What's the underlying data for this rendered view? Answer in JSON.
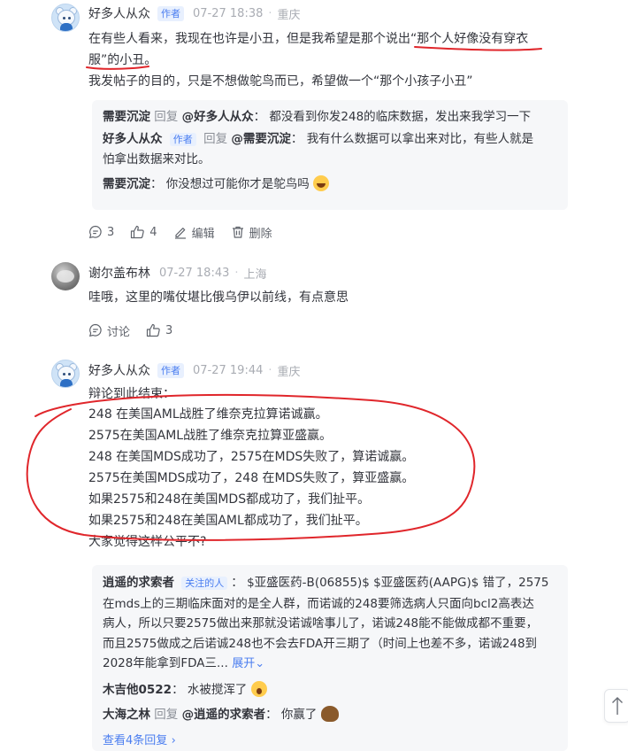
{
  "post1": {
    "username": "好多人从众",
    "badge": "作者",
    "time": "07-27 18:38",
    "location": "重庆",
    "lines": [
      "在有些人看来，我现在也许是小丑，但是我希望是那个说出“那个人好像没有穿衣",
      "服”的小丑。",
      "我发帖子的目的，只是不想做鸵鸟而已，希望做一个“那个小孩子小丑”"
    ],
    "replies": [
      {
        "user": "需要沉淀",
        "reply_label": "回复",
        "target": "@好多人从众",
        "text": "都没看到你发248的临床数据，发出来我学习一下"
      },
      {
        "user": "好多人从众",
        "badge": "作者",
        "reply_label": "回复",
        "target": "@需要沉淀",
        "text_line1": "我有什么数据可以拿出来对比，有些人就是",
        "text_line2": "怕拿出数据来对比。"
      },
      {
        "user": "需要沉淀",
        "text": "你没想过可能你才是鸵鸟吗"
      }
    ],
    "actions": {
      "comments": "3",
      "likes": "4",
      "edit": "编辑",
      "delete": "删除"
    }
  },
  "post2": {
    "username": "谢尔盖布林",
    "time": "07-27 18:43",
    "location": "上海",
    "text": "哇哦，这里的嘴仗堪比俄乌伊以前线，有点意思",
    "actions": {
      "comments": "讨论",
      "likes": "3"
    }
  },
  "post3": {
    "username": "好多人从众",
    "badge": "作者",
    "time": "07-27 19:44",
    "location": "重庆",
    "lines": [
      "辩论到此结束：",
      "248 在美国AML战胜了维奈克拉算诺诚赢。",
      "2575在美国AML战胜了维奈克拉算亚盛赢。",
      "248 在美国MDS成功了，2575在MDS失败了，算诺诚赢。",
      "2575在美国MDS成功了，248 在MDS失败了，算亚盛赢。",
      "如果2575和248在美国MDS都成功了，我们扯平。",
      "如果2575和248在美国AML都成功了，我们扯平。",
      "大家觉得这样公平不?"
    ],
    "replies": [
      {
        "user": "逍遥的求索者",
        "badge": "关注的人",
        "lines": [
          "$亚盛医药-B(06855)$ $亚盛医药(AAPG)$ 错了，2575",
          "在mds上的三期临床面对的是全人群，而诺诚的248要筛选病人只面向bcl2高表达",
          "病人，所以只要2575做出来那就没诺诚啥事儿了，诺诚248能不能做成都不重要，",
          "而且2575做成之后诺诚248也不会去FDA开三期了（时间上也差不多，诺诚248到",
          "2028年能拿到FDA三..."
        ],
        "expand": "展开"
      },
      {
        "user": "木吉他0522",
        "text": "水被搅浑了"
      },
      {
        "user": "大海之林",
        "reply_label": "回复",
        "target": "@逍遥的求索者",
        "text": "你赢了"
      }
    ],
    "more_replies": "查看4条回复"
  },
  "colors": {
    "accent": "#4b7ef0",
    "annotation_red": "#e0262b",
    "reply_bg": "#f6f7f9"
  }
}
